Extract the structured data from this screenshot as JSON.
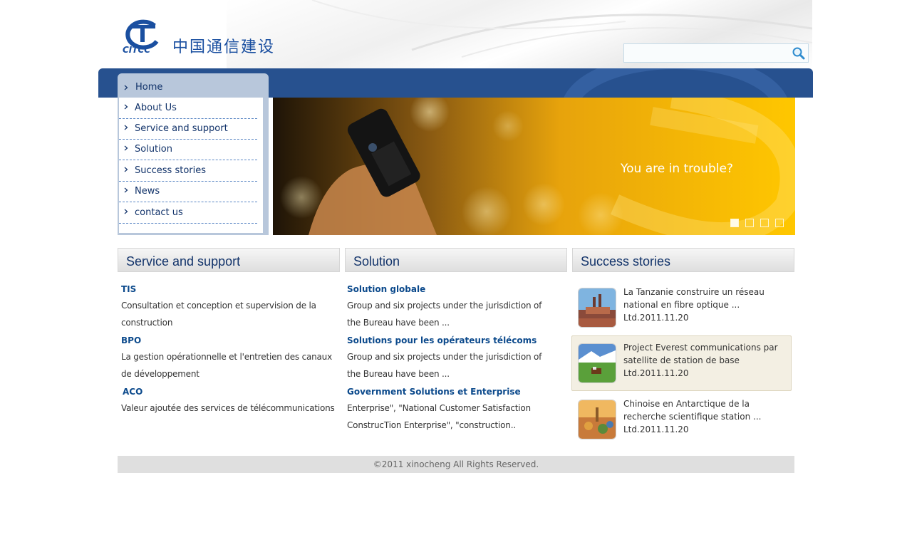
{
  "header": {
    "logo_text_en": "CITCC",
    "logo_text_cn": "中国通信建设",
    "search": {
      "value": "",
      "placeholder": ""
    }
  },
  "colors": {
    "brand_blue": "#27518f",
    "nav_panel": "#b8c7db",
    "link_blue": "#0c4a8c",
    "banner_yellow": "#f7b800"
  },
  "icons": [
    "search-icon",
    "chevron-right-icon",
    "logo-emblem-icon"
  ],
  "nav": {
    "home": "Home",
    "items": [
      {
        "label": "About Us"
      },
      {
        "label": "Service and support"
      },
      {
        "label": "Solution"
      },
      {
        "label": "Success stories"
      },
      {
        "label": "News"
      },
      {
        "label": "contact us"
      }
    ]
  },
  "banner": {
    "caption": "You are in trouble?",
    "slides": 4,
    "active_slide": 1
  },
  "service": {
    "title": "Service and support",
    "entries": [
      {
        "title": "TIS",
        "text": "Consultation et conception et supervision de la construction"
      },
      {
        "title": "BPO",
        "text": "La gestion opérationnelle et l'entretien des canaux de développement"
      },
      {
        "title": "ACO",
        "text": "Valeur ajoutée des services de télécommunications"
      }
    ]
  },
  "solution": {
    "title": "Solution",
    "entries": [
      {
        "title": "Solution globale",
        "text": "Group and six projects under the jurisdiction of the Bureau have been ..."
      },
      {
        "title": "Solutions pour les opérateurs télécoms",
        "text": "Group and six projects under the jurisdiction of the Bureau have been ..."
      },
      {
        "title": "Government Solutions et Enterprise",
        "text": "Enterprise\", \"National Customer Satisfaction ConstrucTion Enterprise\", \"construction.."
      }
    ]
  },
  "stories": {
    "title": "Success stories",
    "items": [
      {
        "text": "La Tanzanie construire un réseau national en fibre optique ...",
        "date": "Ltd.2011.11.20"
      },
      {
        "text": "Project Everest communications par satellite de station de base",
        "date": "Ltd.2011.11.20"
      },
      {
        "text": "Chinoise en Antarctique de la recherche scientifique station ...",
        "date": "Ltd.2011.11.20"
      }
    ]
  },
  "footer": {
    "copyright": "©2011 xinocheng All Rights Reserved."
  }
}
